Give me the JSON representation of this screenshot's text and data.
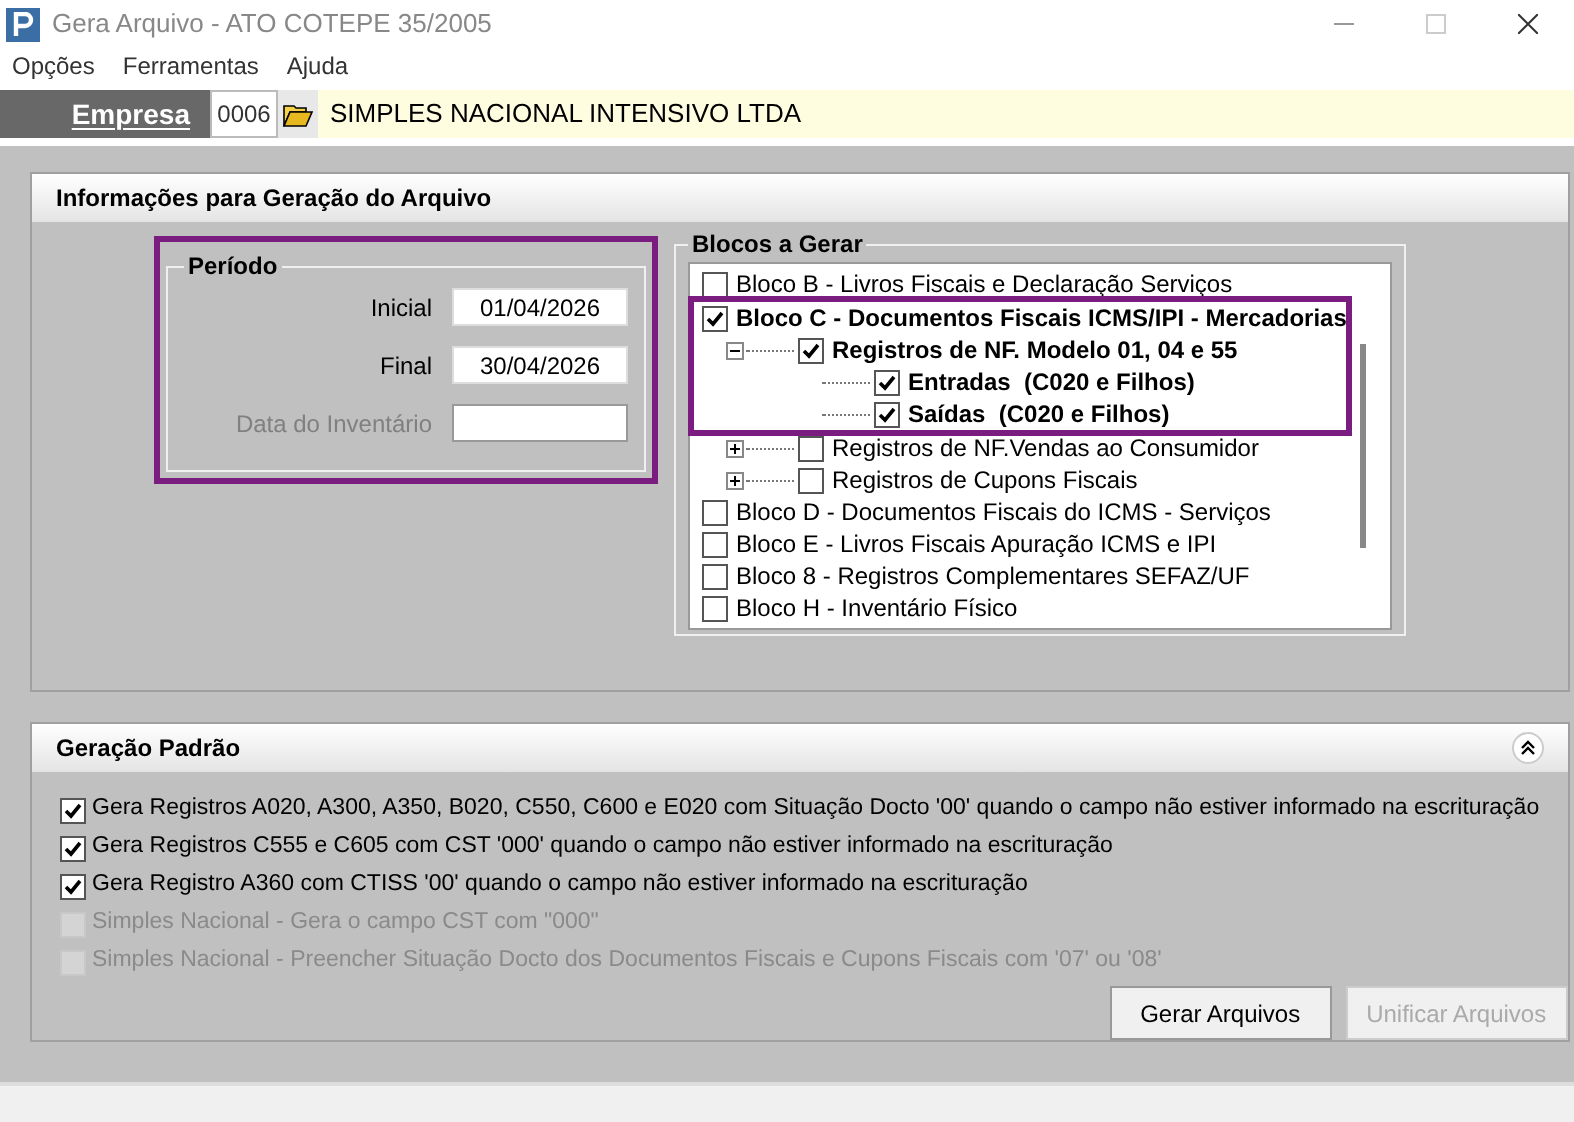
{
  "window": {
    "title": "Gera Arquivo - ATO COTEPE 35/2005"
  },
  "menu": [
    "Opções",
    "Ferramentas",
    "Ajuda"
  ],
  "empresa": {
    "label": "Empresa",
    "code": "0006",
    "name": "SIMPLES NACIONAL INTENSIVO LTDA"
  },
  "info_panel": {
    "title": "Informações para Geração do Arquivo",
    "periodo": {
      "title": "Período",
      "highlighted": true,
      "fields": [
        {
          "label": "Inicial",
          "value": "01/04/2026",
          "disabled": false
        },
        {
          "label": "Final",
          "value": "30/04/2026",
          "disabled": false
        },
        {
          "label": "Data do Inventário",
          "disabled": true
        }
      ]
    },
    "blocos": {
      "title": "Blocos a Gerar",
      "items": [
        {
          "label": "Bloco B - Livros Fiscais e Declaração Serviços",
          "checked": false,
          "highlighted": false
        },
        {
          "label": "Bloco C - Documentos Fiscais ICMS/IPI - Mercadorias",
          "checked": true,
          "highlighted": true,
          "children": [
            {
              "label": "Registros de NF. Modelo 01, 04 e 55",
              "checked": true,
              "highlighted": true,
              "expanded": true,
              "children": [
                {
                  "label": "Entradas  (C020 e Filhos)",
                  "checked": true,
                  "highlighted": true
                },
                {
                  "label": "Saídas  (C020 e Filhos)",
                  "checked": true,
                  "highlighted": true
                }
              ]
            },
            {
              "label": "Registros de NF.Vendas ao Consumidor",
              "checked": false,
              "highlighted": false,
              "expanded": false
            },
            {
              "label": "Registros de Cupons Fiscais",
              "checked": false,
              "highlighted": false,
              "expanded": false
            }
          ]
        },
        {
          "label": "Bloco D - Documentos Fiscais do ICMS - Serviços",
          "checked": false,
          "highlighted": false
        },
        {
          "label": "Bloco E - Livros Fiscais Apuração ICMS e IPI",
          "checked": false,
          "highlighted": false
        },
        {
          "label": "Bloco 8 - Registros Complementares SEFAZ/UF",
          "checked": false,
          "highlighted": false
        },
        {
          "label": "Bloco H - Inventário Físico",
          "checked": false,
          "highlighted": false
        }
      ]
    }
  },
  "geracao_padrao": {
    "title": "Geração Padrão",
    "options": [
      {
        "label": "Gera Registros A020, A300, A350, B020, C550, C600 e E020 com Situação Docto '00' quando o campo não estiver informado na escrituração",
        "checked": true,
        "disabled": false
      },
      {
        "label": "Gera Registros C555 e C605 com CST '000' quando o campo não estiver informado na escrituração",
        "checked": true,
        "disabled": false
      },
      {
        "label": "Gera Registro A360 com CTISS '00' quando o campo não estiver informado na escrituração",
        "checked": true,
        "disabled": false
      },
      {
        "label": "Simples Nacional - Gera o campo CST com \"000\"",
        "checked": false,
        "disabled": true
      },
      {
        "label": "Simples Nacional - Preencher Situação Docto dos Documentos Fiscais e Cupons Fiscais com '07' ou '08'",
        "checked": false,
        "disabled": true
      }
    ]
  },
  "buttons": [
    {
      "label": "Gerar Arquivos",
      "disabled": false
    },
    {
      "label": "Unificar Arquivos",
      "disabled": true
    }
  ]
}
